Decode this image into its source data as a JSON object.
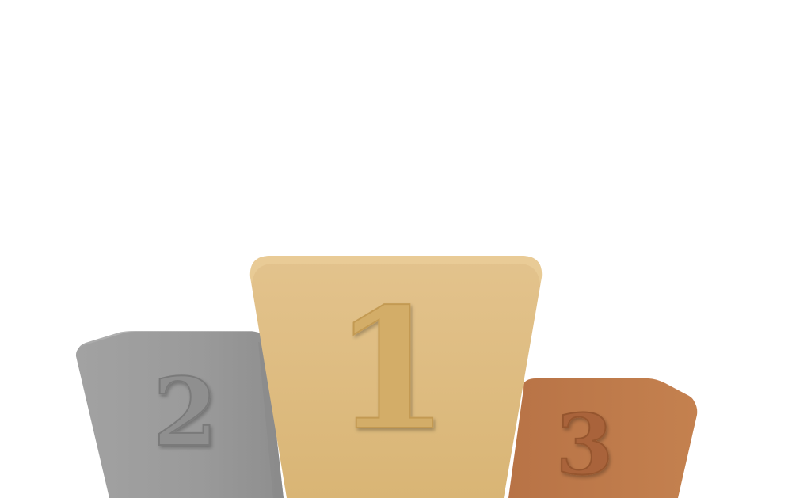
{
  "podium": {
    "first": {
      "label": "1",
      "color": "#dcb978"
    },
    "second": {
      "label": "2",
      "color": "#9c9c9c"
    },
    "third": {
      "label": "3",
      "color": "#c07a4a"
    }
  }
}
